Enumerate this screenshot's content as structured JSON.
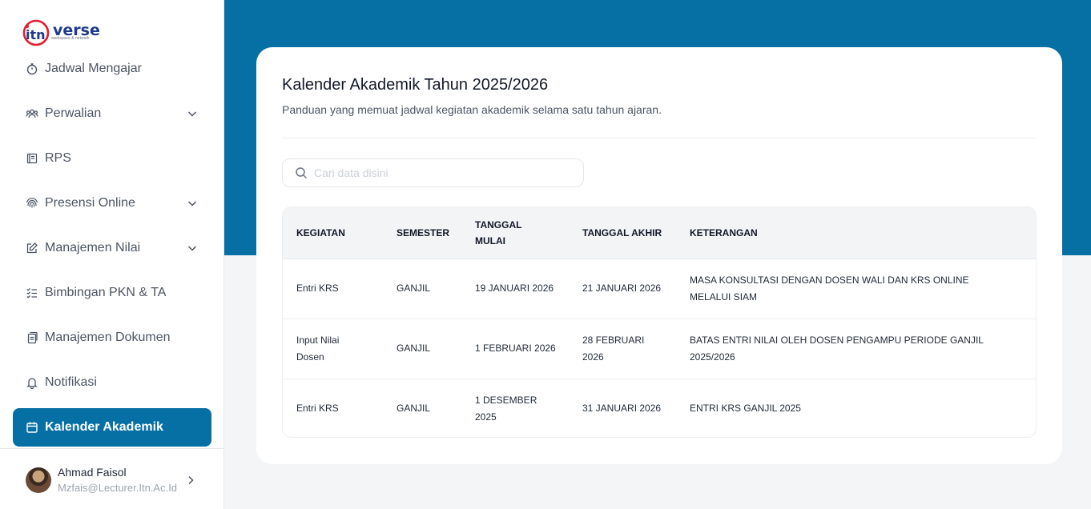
{
  "brand": {
    "name": "verse",
    "tagline": "workspace & network"
  },
  "sidebar": {
    "items": [
      {
        "label": "Jadwal Mengajar",
        "icon": "stopwatch-icon",
        "has_chevron": false,
        "active": false
      },
      {
        "label": "Perwalian",
        "icon": "users-icon",
        "has_chevron": true,
        "active": false
      },
      {
        "label": "RPS",
        "icon": "book-icon",
        "has_chevron": false,
        "active": false
      },
      {
        "label": "Presensi Online",
        "icon": "fingerprint-icon",
        "has_chevron": true,
        "active": false
      },
      {
        "label": "Manajemen Nilai",
        "icon": "edit-icon",
        "has_chevron": true,
        "active": false
      },
      {
        "label": "Bimbingan PKN & TA",
        "icon": "checklist-icon",
        "has_chevron": false,
        "active": false
      },
      {
        "label": "Manajemen Dokumen",
        "icon": "documents-icon",
        "has_chevron": false,
        "active": false
      },
      {
        "label": "Notifikasi",
        "icon": "bell-icon",
        "has_chevron": false,
        "active": false
      },
      {
        "label": "Kalender Akademik",
        "icon": "calendar-icon",
        "has_chevron": false,
        "active": true
      }
    ]
  },
  "profile": {
    "name": "Ahmad Faisol",
    "email": "Mzfais@Lecturer.Itn.Ac.Id"
  },
  "main": {
    "title": "Kalender Akademik Tahun 2025/2026",
    "subtitle": "Panduan yang memuat jadwal kegiatan akademik selama satu tahun ajaran.",
    "search": {
      "placeholder": "Cari data disini",
      "value": ""
    },
    "table": {
      "headers": [
        "KEGIATAN",
        "SEMESTER",
        "TANGGAL MULAI",
        "TANGGAL AKHIR",
        "KETERANGAN"
      ],
      "rows": [
        [
          "Entri KRS",
          "GANJIL",
          "19 JANUARI 2026",
          "21 JANUARI 2026",
          "MASA KONSULTASI DENGAN DOSEN WALI DAN KRS ONLINE MELALUI SIAM"
        ],
        [
          "Input Nilai Dosen",
          "GANJIL",
          "1 FEBRUARI 2026",
          "28 FEBRUARI 2026",
          "BATAS ENTRI NILAI OLEH DOSEN PENGAMPU PERIODE GANJIL 2025/2026"
        ],
        [
          "Entri KRS",
          "GANJIL",
          "1 DESEMBER 2025",
          "31 JANUARI 2026",
          "ENTRI KRS GANJIL 2025"
        ]
      ]
    }
  },
  "colors": {
    "primary": "#0670a4",
    "background": "#f4f5f7",
    "logo_red": "#e11d2e",
    "logo_blue": "#1e3a8a"
  }
}
